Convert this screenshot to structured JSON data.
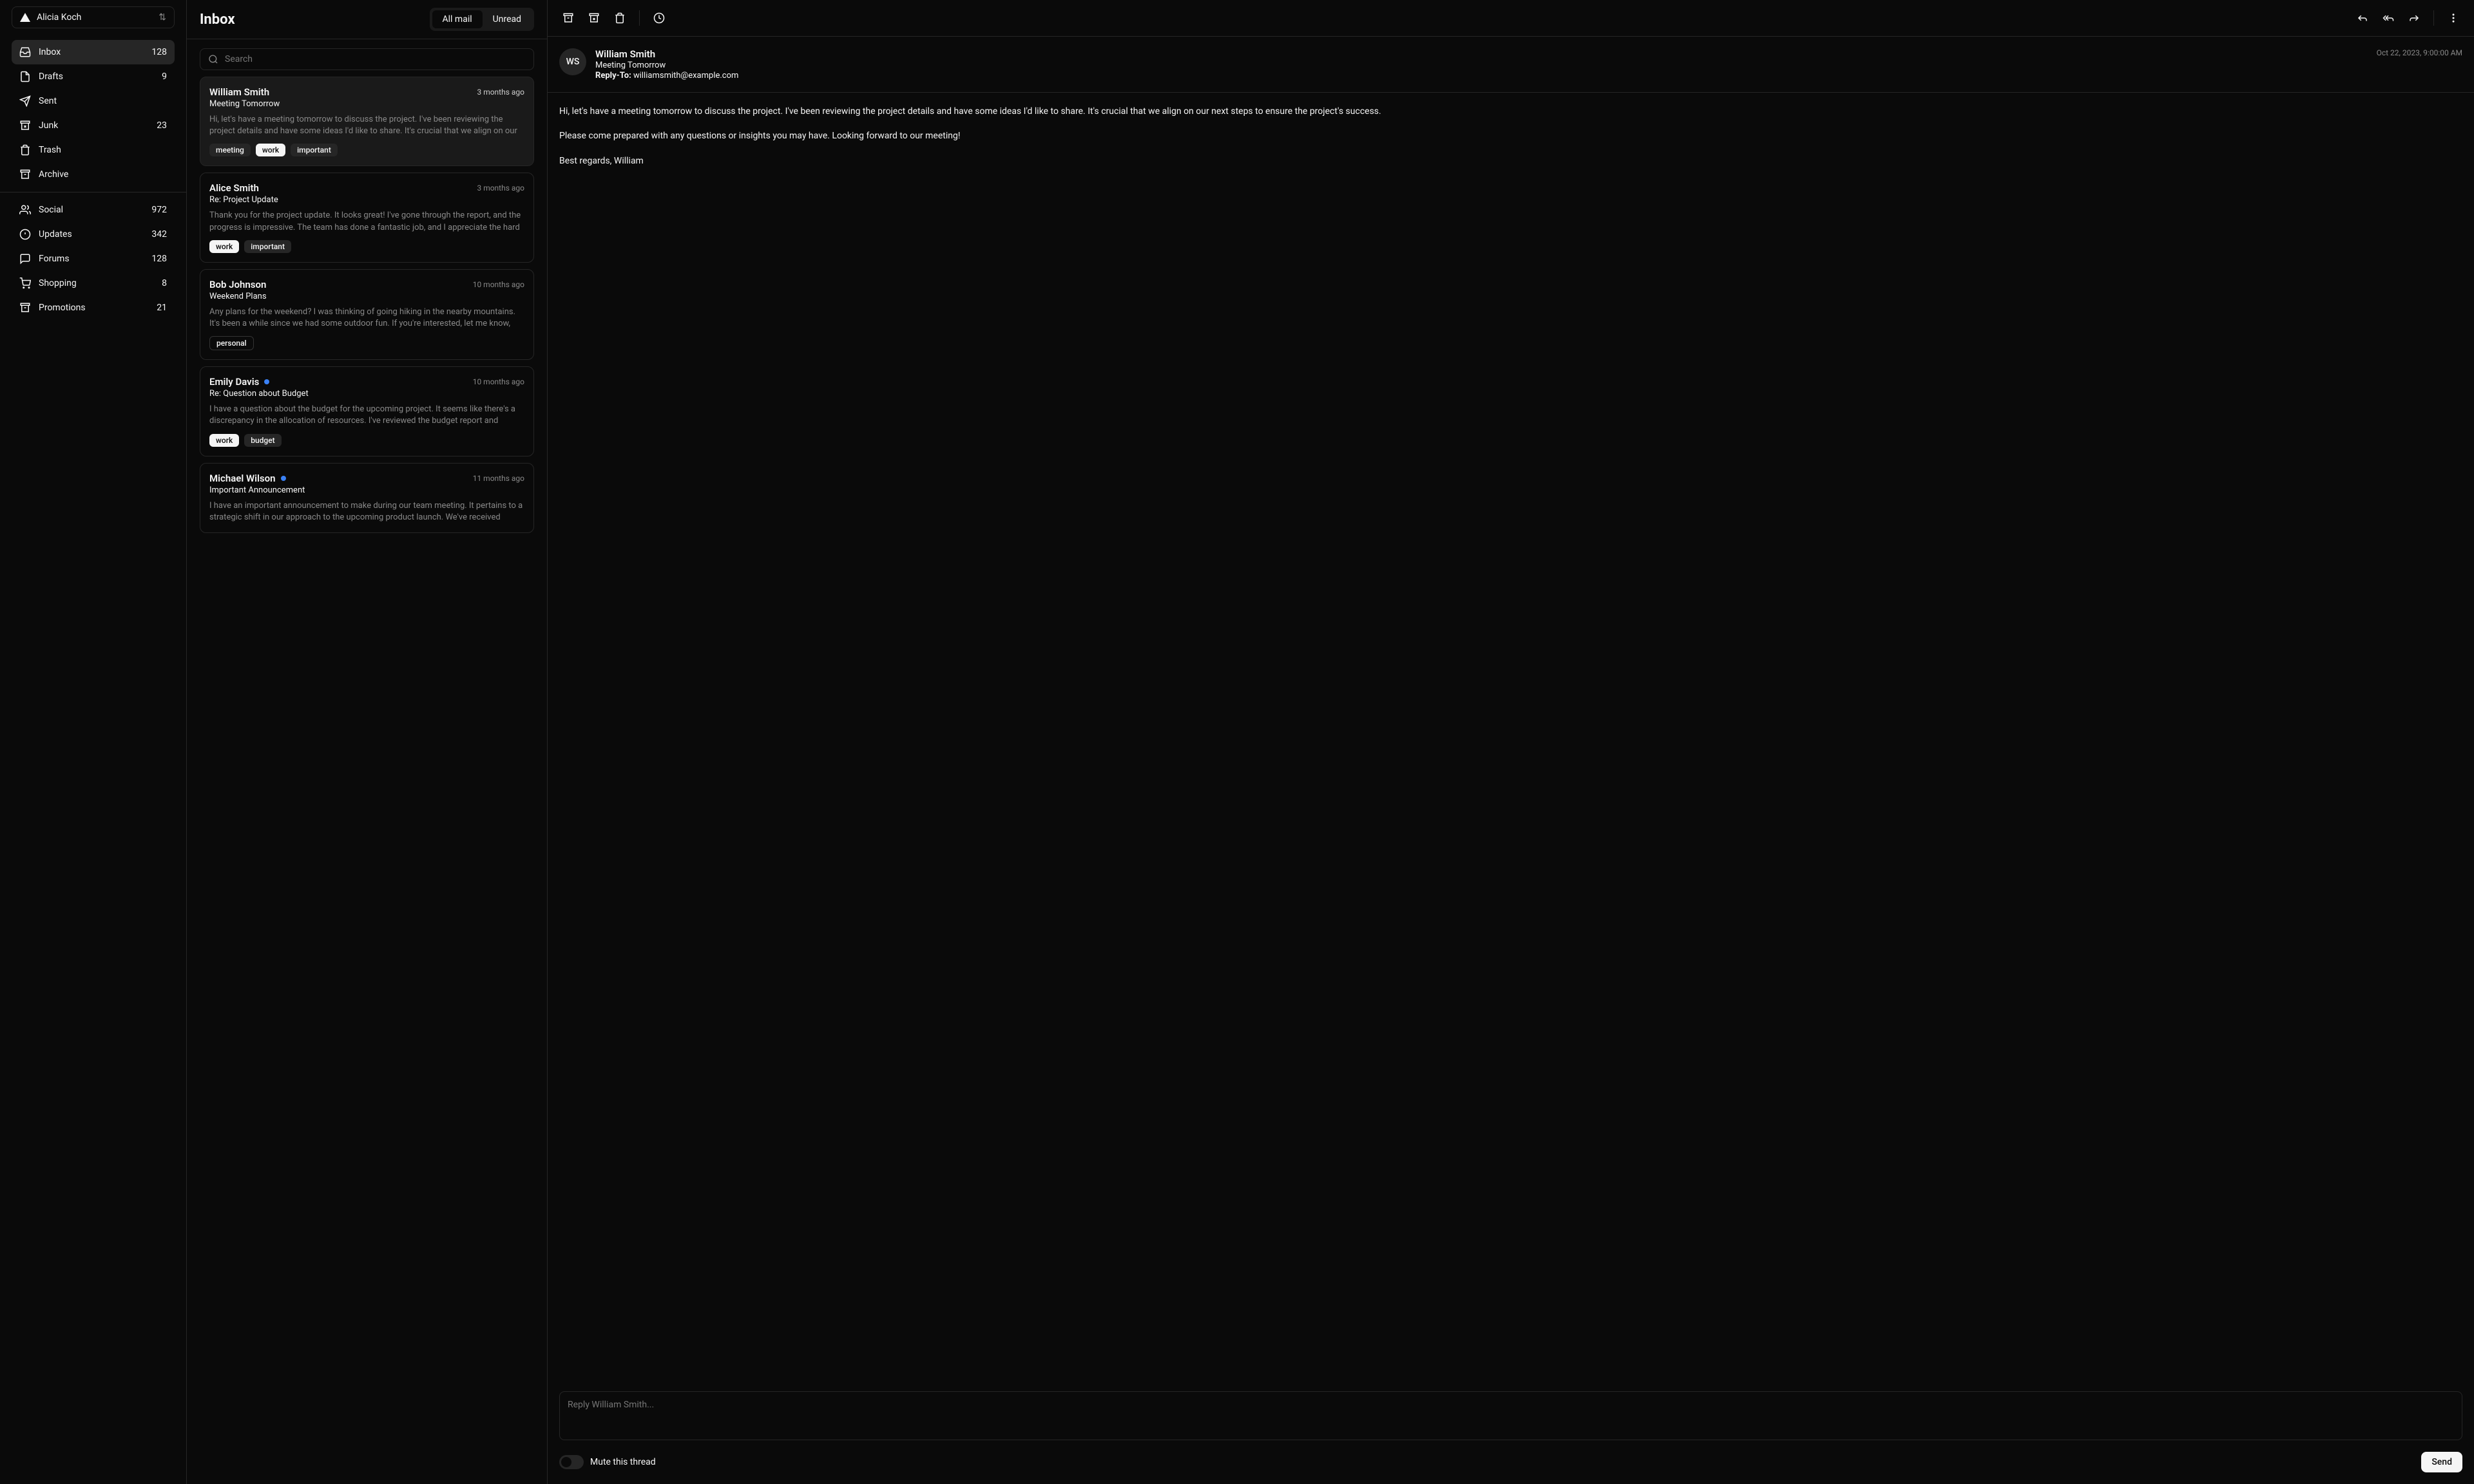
{
  "account": {
    "name": "Alicia Koch"
  },
  "sidebar": {
    "primary": [
      {
        "id": "inbox",
        "label": "Inbox",
        "count": "128",
        "active": true
      },
      {
        "id": "drafts",
        "label": "Drafts",
        "count": "9"
      },
      {
        "id": "sent",
        "label": "Sent",
        "count": ""
      },
      {
        "id": "junk",
        "label": "Junk",
        "count": "23"
      },
      {
        "id": "trash",
        "label": "Trash",
        "count": ""
      },
      {
        "id": "archive",
        "label": "Archive",
        "count": ""
      }
    ],
    "secondary": [
      {
        "id": "social",
        "label": "Social",
        "count": "972"
      },
      {
        "id": "updates",
        "label": "Updates",
        "count": "342"
      },
      {
        "id": "forums",
        "label": "Forums",
        "count": "128"
      },
      {
        "id": "shopping",
        "label": "Shopping",
        "count": "8"
      },
      {
        "id": "promotions",
        "label": "Promotions",
        "count": "21"
      }
    ]
  },
  "inbox": {
    "title": "Inbox",
    "tabs": {
      "all": "All mail",
      "unread": "Unread"
    },
    "search_placeholder": "Search"
  },
  "mails": [
    {
      "sender": "William Smith",
      "subject": "Meeting Tomorrow",
      "time": "3 months ago",
      "preview": "Hi, let's have a meeting tomorrow to discuss the project. I've been reviewing the project details and have some ideas I'd like to share. It's crucial that we align on our",
      "tags": [
        {
          "label": "meeting",
          "style": "tag"
        },
        {
          "label": "work",
          "style": "tag inverse"
        },
        {
          "label": "important",
          "style": "tag"
        }
      ],
      "selected": true,
      "unread": false
    },
    {
      "sender": "Alice Smith",
      "subject": "Re: Project Update",
      "time": "3 months ago",
      "preview": "Thank you for the project update. It looks great! I've gone through the report, and the progress is impressive. The team has done a fantastic job, and I appreciate the hard",
      "tags": [
        {
          "label": "work",
          "style": "tag inverse"
        },
        {
          "label": "important",
          "style": "tag"
        }
      ]
    },
    {
      "sender": "Bob Johnson",
      "subject": "Weekend Plans",
      "time": "10 months ago",
      "preview": "Any plans for the weekend? I was thinking of going hiking in the nearby mountains. It's been a while since we had some outdoor fun. If you're interested, let me know,",
      "tags": [
        {
          "label": "personal",
          "style": "tag outline"
        }
      ]
    },
    {
      "sender": "Emily Davis",
      "subject": "Re: Question about Budget",
      "time": "10 months ago",
      "preview": "I have a question about the budget for the upcoming project. It seems like there's a discrepancy in the allocation of resources. I've reviewed the budget report and",
      "tags": [
        {
          "label": "work",
          "style": "tag inverse"
        },
        {
          "label": "budget",
          "style": "tag"
        }
      ],
      "unread": true
    },
    {
      "sender": "Michael Wilson",
      "subject": "Important Announcement",
      "time": "11 months ago",
      "preview": "I have an important announcement to make during our team meeting. It pertains to a strategic shift in our approach to the upcoming product launch. We've received",
      "tags": [],
      "unread": true
    }
  ],
  "detail": {
    "avatar": "WS",
    "from": "William Smith",
    "subject": "Meeting Tomorrow",
    "reply_to_label": "Reply-To:",
    "reply_to": "williamsmith@example.com",
    "date": "Oct 22, 2023, 9:00:00 AM",
    "body_p1": "Hi, let's have a meeting tomorrow to discuss the project. I've been reviewing the project details and have some ideas I'd like to share. It's crucial that we align on our next steps to ensure the project's success.",
    "body_p2": "Please come prepared with any questions or insights you may have. Looking forward to our meeting!",
    "body_p3": "Best regards, William"
  },
  "reply": {
    "placeholder": "Reply William Smith...",
    "mute_label": "Mute this thread",
    "send_label": "Send"
  }
}
